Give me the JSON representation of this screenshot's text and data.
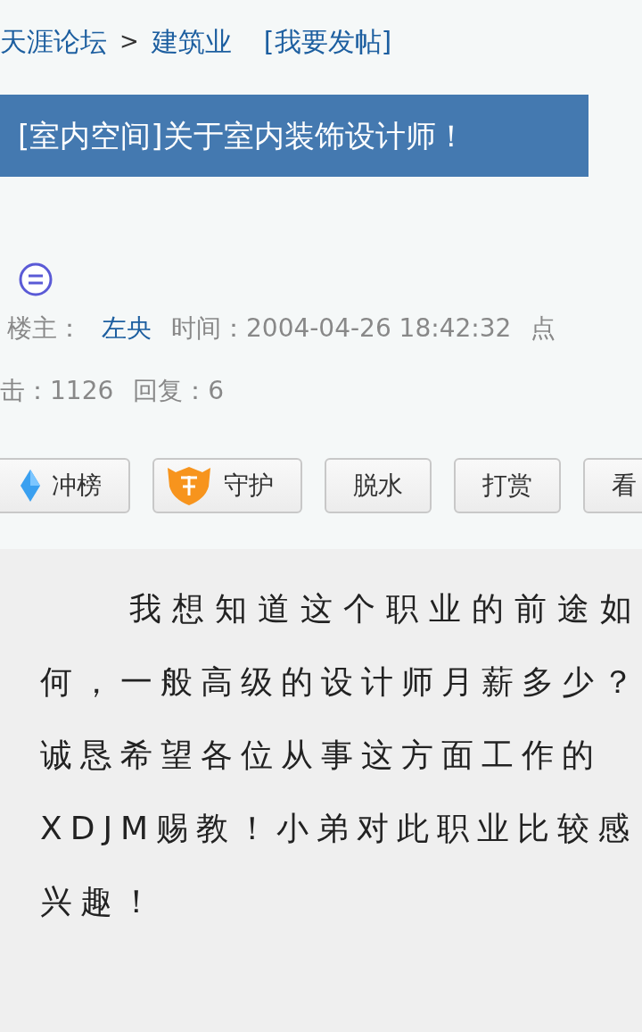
{
  "breadcrumb": [
    {
      "label": "天涯论坛",
      "kind": "link"
    },
    {
      "label": ">",
      "kind": "separator"
    },
    {
      "label": "建筑业",
      "kind": "link"
    },
    {
      "label": "[我要发帖]",
      "kind": "action"
    }
  ],
  "post_title": "[室内空间]关于室内装饰设计师！",
  "meta_lines": [
    [
      {
        "text": "楼主：",
        "kind": "label"
      },
      {
        "text": "左央",
        "kind": "link"
      },
      {
        "text": "时间：2004-04-26 18:42:32",
        "kind": "label"
      },
      {
        "text": "点",
        "kind": "label"
      }
    ],
    [
      {
        "text": "击：1126",
        "kind": "label"
      },
      {
        "text": "回复：6",
        "kind": "label"
      }
    ]
  ],
  "actions": [
    {
      "label": "冲榜",
      "kind": "diamond"
    },
    {
      "label": "守护",
      "kind": "shield"
    },
    {
      "label": "脱水"
    },
    {
      "label": "打赏"
    },
    {
      "label": "看"
    }
  ],
  "content_lines": [
    "我想知道这个职业的前途如",
    "何，一般高级的设计师月薪多少？",
    "诚恳希望各位从事这方面工作的",
    "XDJM赐教！小弟对此职业比较感",
    "兴趣！"
  ]
}
